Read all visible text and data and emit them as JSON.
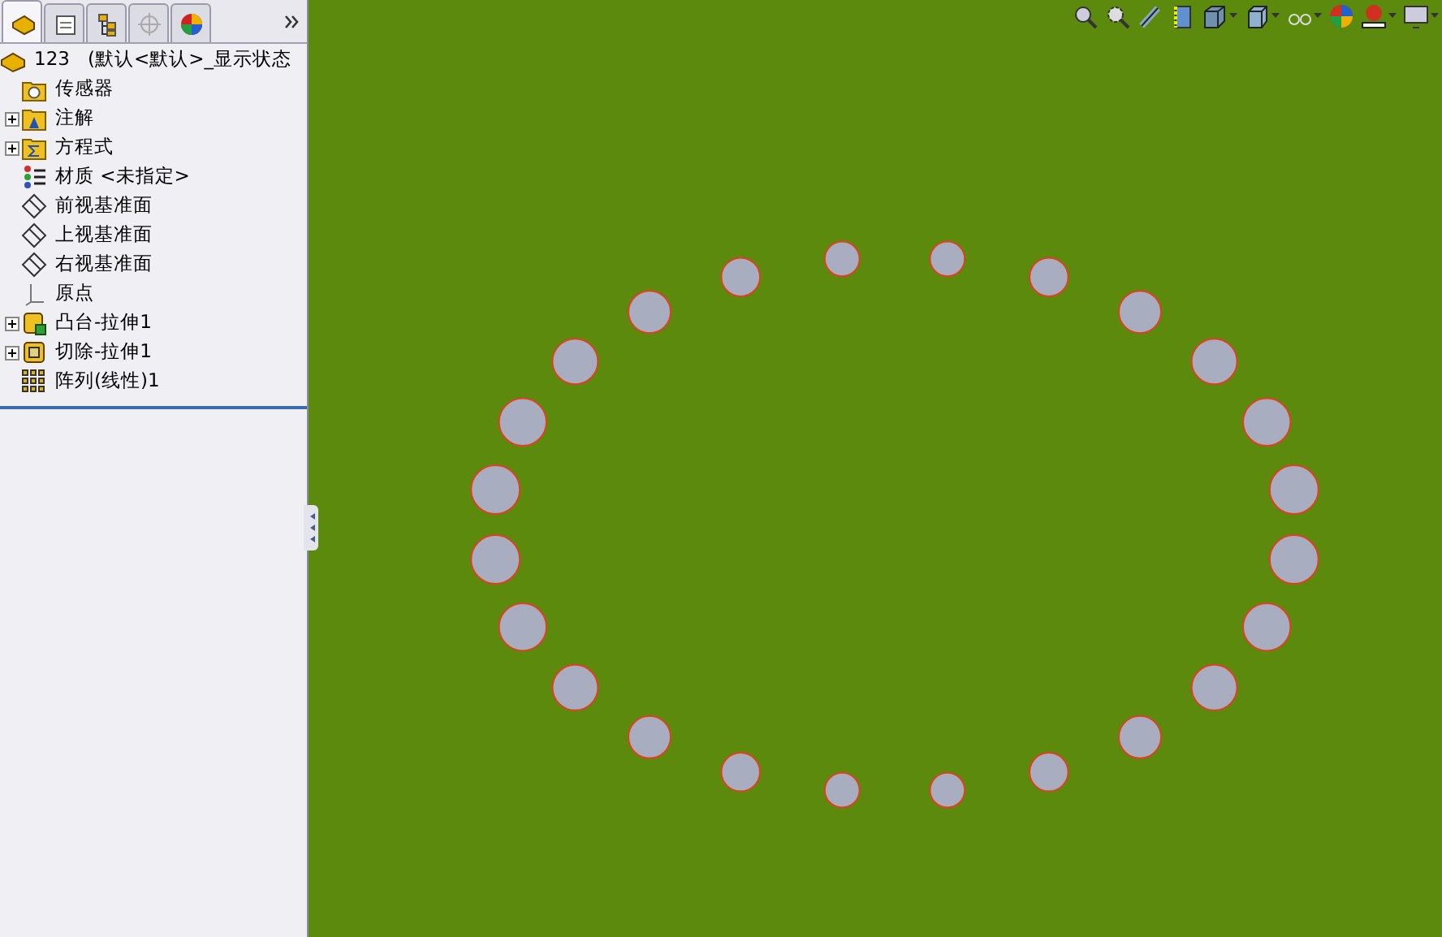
{
  "panel_tabs": [
    {
      "selected": true
    },
    {
      "selected": false
    },
    {
      "selected": false
    },
    {
      "selected": false
    },
    {
      "selected": false
    }
  ],
  "tree": {
    "root": {
      "name": "123",
      "config": "(默认<默认>_显示状态"
    },
    "items": [
      {
        "kind": "sensor",
        "label": "传感器",
        "expandable": false
      },
      {
        "kind": "annotation",
        "label": "注解",
        "expandable": true
      },
      {
        "kind": "equation",
        "label": "方程式",
        "expandable": true
      },
      {
        "kind": "material",
        "label": "材质 <未指定>",
        "expandable": false
      },
      {
        "kind": "plane",
        "label": "前视基准面",
        "expandable": false
      },
      {
        "kind": "plane",
        "label": "上视基准面",
        "expandable": false
      },
      {
        "kind": "plane",
        "label": "右视基准面",
        "expandable": false
      },
      {
        "kind": "origin",
        "label": "原点",
        "expandable": false
      },
      {
        "kind": "boss",
        "label": "凸台-拉伸1",
        "expandable": true
      },
      {
        "kind": "cut",
        "label": "切除-拉伸1",
        "expandable": true
      },
      {
        "kind": "pattern",
        "label": "阵列(线性)1",
        "expandable": false
      }
    ]
  }
}
